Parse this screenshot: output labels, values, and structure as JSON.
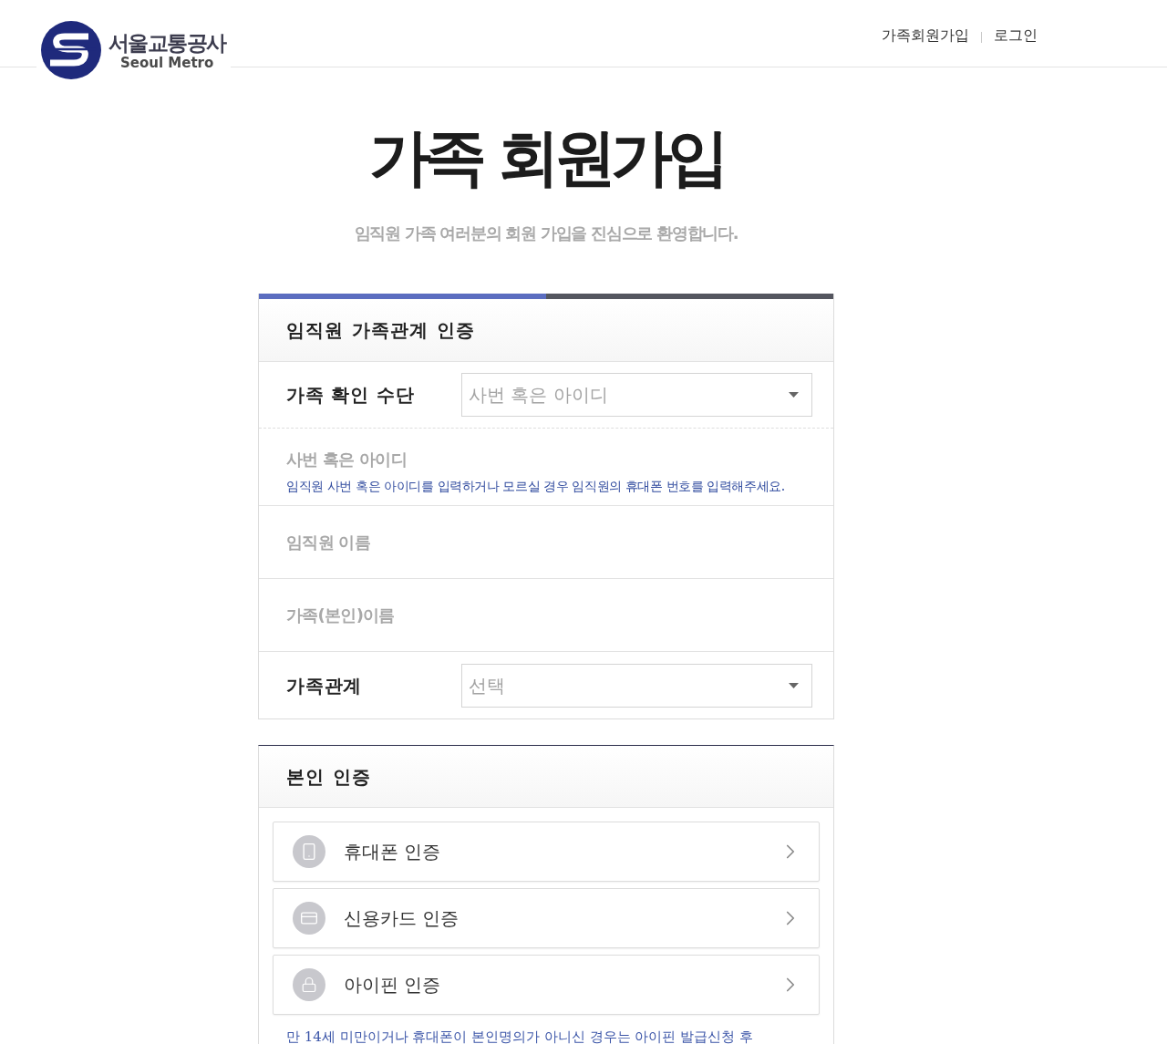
{
  "header": {
    "logo": {
      "name_ko": "서울교통공사",
      "name_en": "Seoul Metro"
    },
    "nav_links": [
      "가족회원가입",
      "로그인"
    ]
  },
  "hero": {
    "title": "가족 회원가입",
    "subtitle": "임직원 가족 여러분의 회원 가입을 진심으로 환영합니다."
  },
  "family_section": {
    "progress": {
      "level": 0.5
    },
    "title": "임직원 가족관계 인증",
    "rows": [
      {
        "kind": "select",
        "label": "가족 확인 수단",
        "placeholder": "사번 혹은 아이디"
      },
      {
        "kind": "input",
        "placeholder": "사번 혹은 아이디",
        "hint": "임직원 사번 혹은 아이디를 입력하거나 모르실 경우 임직원의 휴대폰 번호를 입력해주세요."
      },
      {
        "kind": "input",
        "placeholder": "임직원 이름"
      },
      {
        "kind": "input",
        "placeholder": "가족(본인)이름"
      },
      {
        "kind": "select",
        "label": "가족관계",
        "placeholder": "선택"
      }
    ]
  },
  "identity_section": {
    "title": "본인 인증",
    "options": [
      {
        "kind": "phone",
        "label": "휴대폰 인증"
      },
      {
        "kind": "card",
        "label": "신용카드 인증"
      },
      {
        "kind": "lock",
        "label": "아이핀 인증"
      }
    ],
    "note": "만 14세 미만이거나 휴대폰이 본인명의가 아니신 경우는 아이핀 발급신청 후"
  }
}
